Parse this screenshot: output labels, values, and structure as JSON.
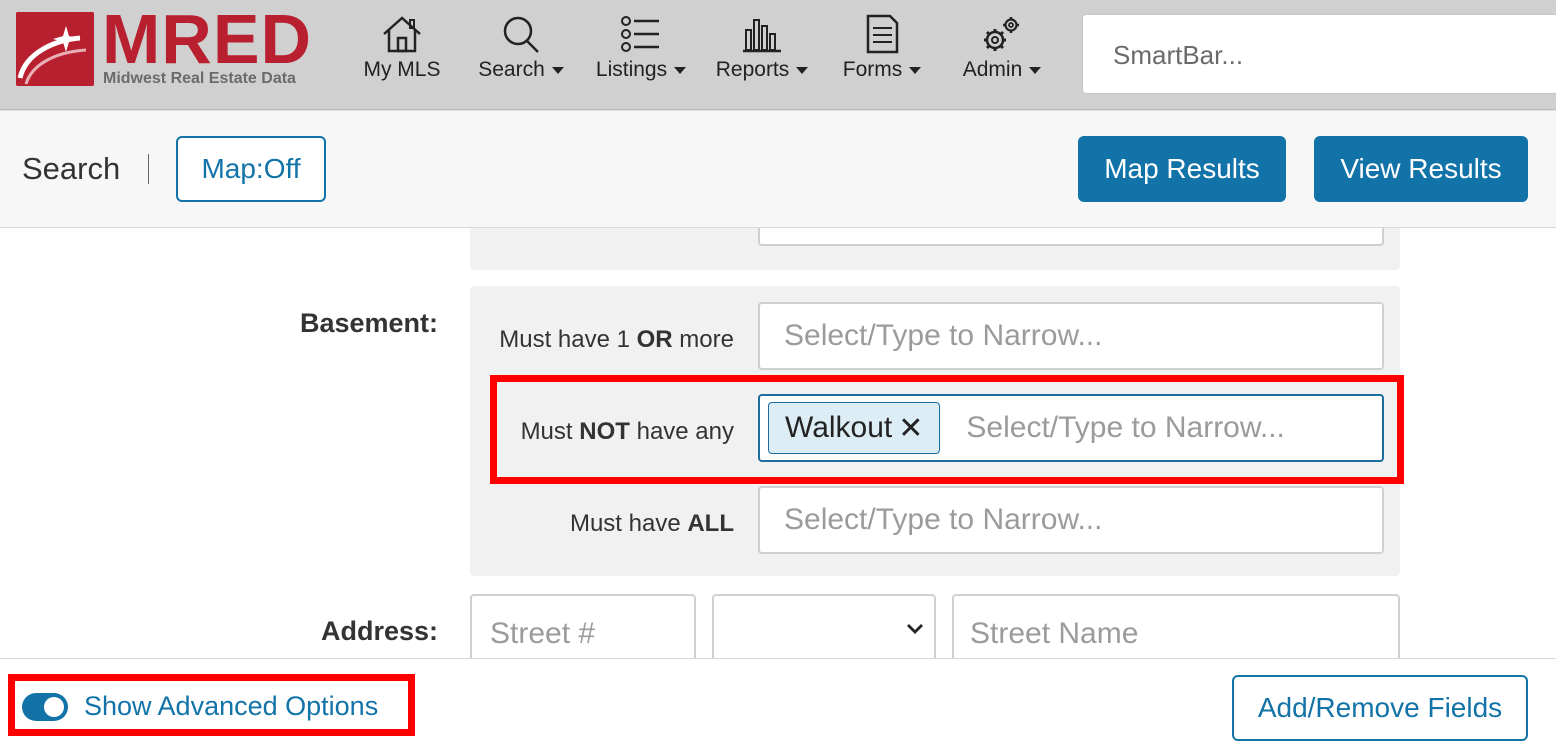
{
  "brand": {
    "logo_text": "MRED",
    "logo_subtitle": "Midwest Real Estate Data",
    "primary_color": "#b8202f"
  },
  "nav": {
    "items": [
      {
        "label": "My MLS",
        "icon": "house-icon",
        "has_caret": false
      },
      {
        "label": "Search",
        "icon": "magnifier-icon",
        "has_caret": true
      },
      {
        "label": "Listings",
        "icon": "list-icon",
        "has_caret": true
      },
      {
        "label": "Reports",
        "icon": "bar-chart-icon",
        "has_caret": true
      },
      {
        "label": "Forms",
        "icon": "document-icon",
        "has_caret": true
      },
      {
        "label": "Admin",
        "icon": "gears-icon",
        "has_caret": true
      }
    ],
    "smartbar_placeholder": "SmartBar..."
  },
  "header": {
    "title": "Search",
    "map_toggle_label": "Map:Off",
    "map_results_label": "Map Results",
    "view_results_label": "View Results",
    "accent_color": "#1273a8"
  },
  "form": {
    "basement": {
      "label": "Basement:",
      "rows": [
        {
          "prefix": "Must have 1 ",
          "strong": "OR",
          "suffix": " more",
          "placeholder": "Select/Type to Narrow..."
        },
        {
          "prefix": "Must ",
          "strong": "NOT",
          "suffix": " have any",
          "placeholder": "Select/Type to Narrow...",
          "chips": [
            "Walkout"
          ]
        },
        {
          "prefix": "Must have ",
          "strong": "ALL",
          "suffix": "",
          "placeholder": "Select/Type to Narrow..."
        }
      ]
    },
    "address": {
      "label": "Address:",
      "street_number_placeholder": "Street #",
      "direction_value": "",
      "street_name_placeholder": "Street Name"
    }
  },
  "footer": {
    "advanced_toggle_label": "Show Advanced Options",
    "advanced_toggle_on": true,
    "add_remove_label": "Add/Remove Fields"
  },
  "annotation_color": "#ff0000"
}
